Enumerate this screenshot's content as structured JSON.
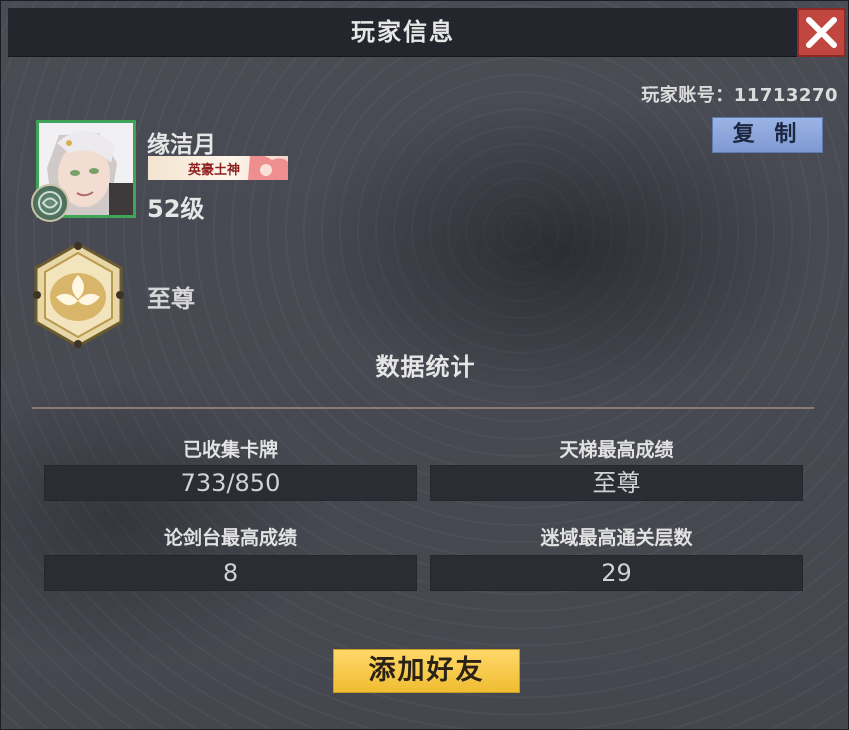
{
  "window": {
    "title": "玩家信息"
  },
  "account": {
    "label": "玩家账号：",
    "id": "11713270",
    "copy_label": "复 制"
  },
  "player": {
    "name": "缘洁月",
    "title_badge": "英豪土神",
    "level": "52级",
    "rank": "至尊"
  },
  "stats": {
    "section_title": "数据统计",
    "items": [
      {
        "label": "已收集卡牌",
        "value": "733/850"
      },
      {
        "label": "天梯最高成绩",
        "value": "至尊"
      },
      {
        "label": "论剑台最高成绩",
        "value": "8"
      },
      {
        "label": "迷域最高通关层数",
        "value": "29"
      }
    ]
  },
  "actions": {
    "add_friend_label": "添加好友"
  },
  "icons": {
    "close": "close-icon",
    "rank": "rank-emblem-icon",
    "avatar_badge": "jade-badge-icon"
  },
  "colors": {
    "close_bg": "#c0463f",
    "copy_bg": "#8ea8de",
    "add_friend_bg": "#f6c844",
    "avatar_border": "#3fa35a"
  }
}
